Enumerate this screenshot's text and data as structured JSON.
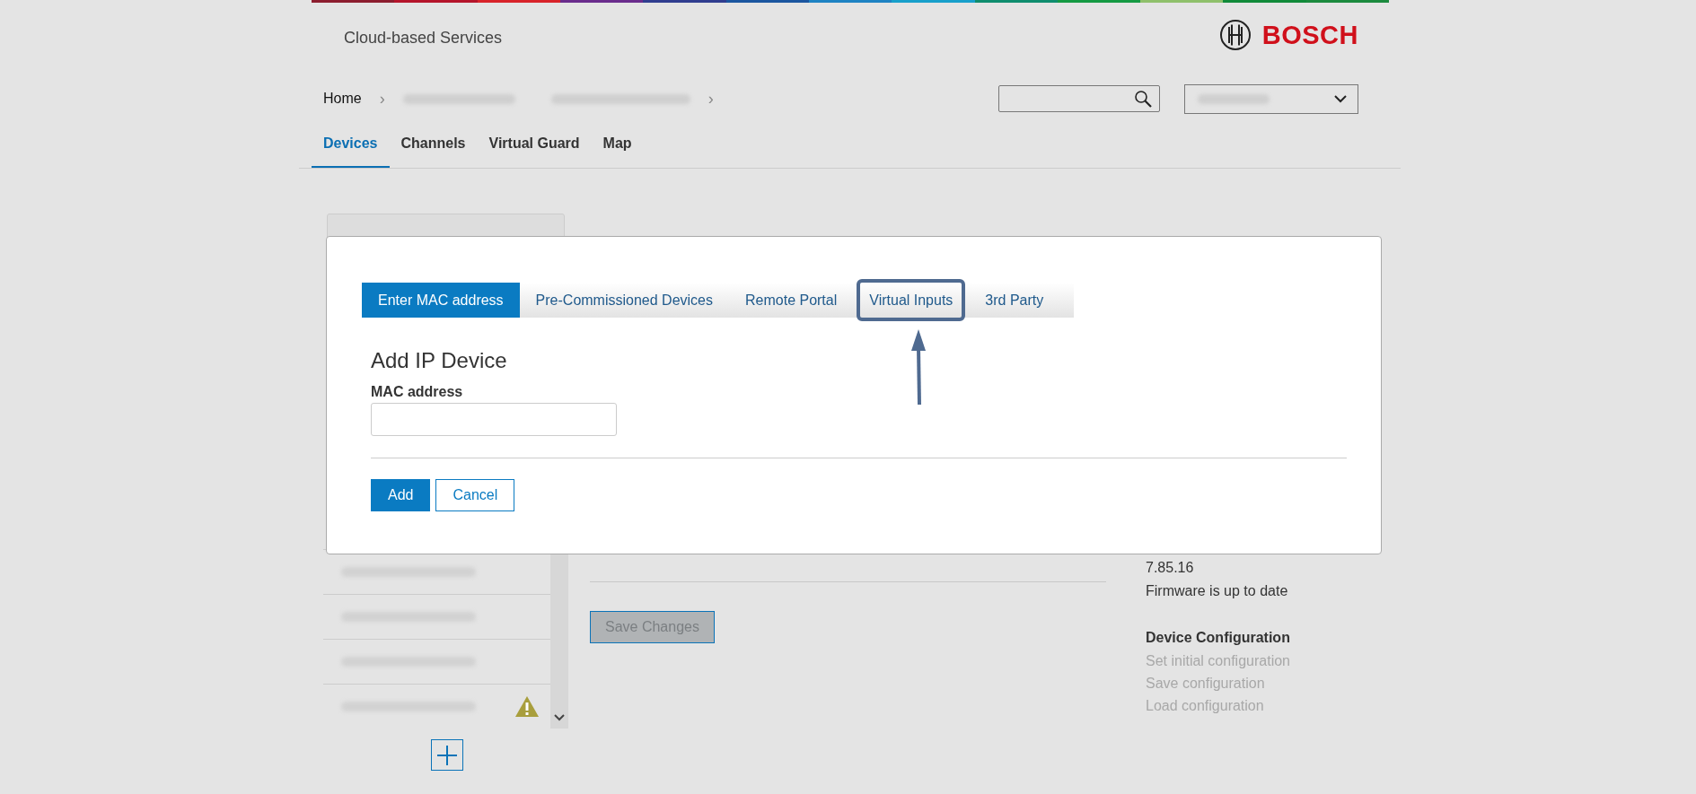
{
  "header": {
    "title": "Cloud-based Services",
    "logo": "BOSCH"
  },
  "breadcrumb": {
    "home": "Home",
    "separator": "›"
  },
  "nav_tabs": [
    {
      "label": "Devices",
      "selected": true
    },
    {
      "label": "Channels",
      "selected": false
    },
    {
      "label": "Virtual Guard",
      "selected": false
    },
    {
      "label": "Map",
      "selected": false
    }
  ],
  "device_list": {
    "rows": [
      {
        "warning": false
      },
      {
        "warning": false
      },
      {
        "warning": false
      },
      {
        "warning": true
      }
    ]
  },
  "save_button": {
    "label": "Save Changes",
    "disabled": true
  },
  "firmware": {
    "version": "7.85.16",
    "status": "Firmware is up to date"
  },
  "device_configuration": {
    "title": "Device Configuration",
    "actions": [
      {
        "label": "Set initial configuration",
        "disabled": true
      },
      {
        "label": "Save configuration",
        "disabled": true
      },
      {
        "label": "Load configuration",
        "disabled": true
      }
    ]
  },
  "dialog": {
    "tabs": [
      {
        "label": "Enter MAC address",
        "selected": true,
        "highlighted": false
      },
      {
        "label": "Pre-Commissioned Devices",
        "selected": false,
        "highlighted": false
      },
      {
        "label": "Remote Portal",
        "selected": false,
        "highlighted": false
      },
      {
        "label": "Virtual Inputs",
        "selected": false,
        "highlighted": true
      },
      {
        "label": "3rd Party",
        "selected": false,
        "highlighted": false
      }
    ],
    "heading": "Add IP Device",
    "field": {
      "label": "MAC address"
    },
    "buttons": [
      {
        "label": "Add",
        "kind": "primary"
      },
      {
        "label": "Cancel",
        "kind": "secondary"
      }
    ]
  }
}
